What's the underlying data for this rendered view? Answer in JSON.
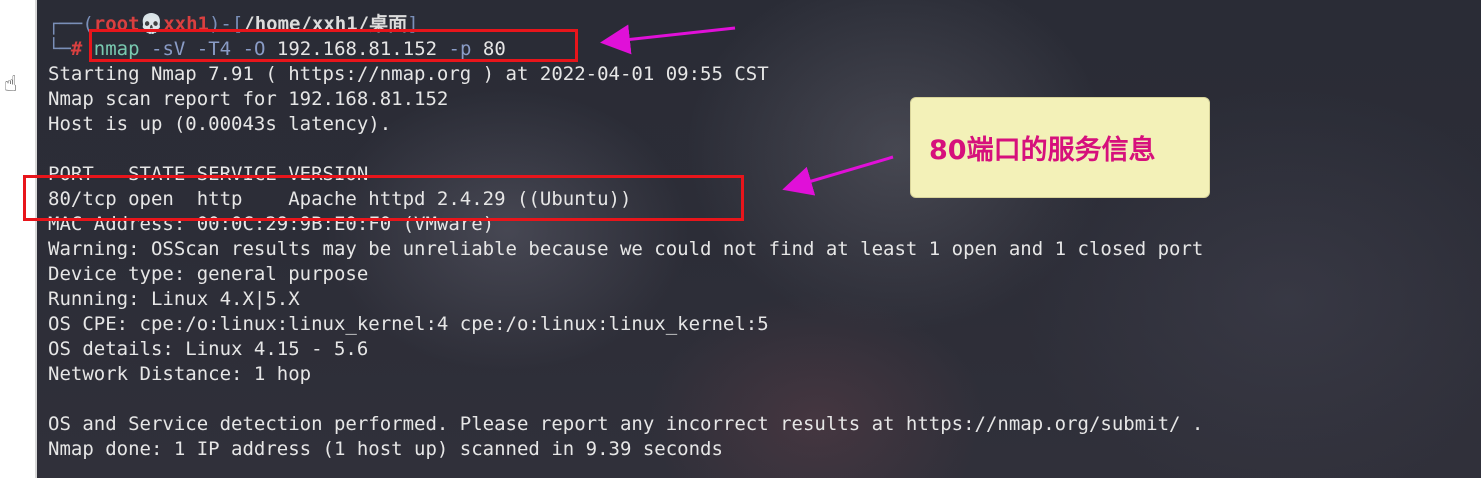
{
  "prompt": {
    "line1_prefix": "┌──(",
    "user": "root",
    "skull": "💀",
    "host": "xxh1",
    "mid": ")-[",
    "path": "/home/xxh1/桌面",
    "end": "]",
    "line2_prefix": "└─",
    "hash": "#",
    "cmd": "nmap",
    "flag1": "-sV",
    "flag2": "-T4",
    "flag3": "-O",
    "target": "192.168.81.152",
    "flag4": "-p",
    "port": "80"
  },
  "output": [
    "Starting Nmap 7.91 ( https://nmap.org ) at 2022-04-01 09:55 CST",
    "Nmap scan report for 192.168.81.152",
    "Host is up (0.00043s latency).",
    "",
    "PORT   STATE SERVICE VERSION",
    "80/tcp open  http    Apache httpd 2.4.29 ((Ubuntu))",
    "MAC Address: 00:0C:29:9B:E0:F0 (VMware)",
    "Warning: OSScan results may be unreliable because we could not find at least 1 open and 1 closed port",
    "Device type: general purpose",
    "Running: Linux 4.X|5.X",
    "OS CPE: cpe:/o:linux:linux_kernel:4 cpe:/o:linux:linux_kernel:5",
    "OS details: Linux 4.15 - 5.6",
    "Network Distance: 1 hop",
    "",
    "OS and Service detection performed. Please report any incorrect results at https://nmap.org/submit/ .",
    "Nmap done: 1 IP address (1 host up) scanned in 9.39 seconds"
  ],
  "annotation": {
    "callout_text": "80端口的服务信息",
    "box_color": "#e8151b",
    "arrow_color": "#e010d8",
    "callout_bg": "#f3f1b8",
    "callout_text_color": "#d6107c"
  },
  "icons": {
    "cursor": "hand-pointer-icon"
  }
}
